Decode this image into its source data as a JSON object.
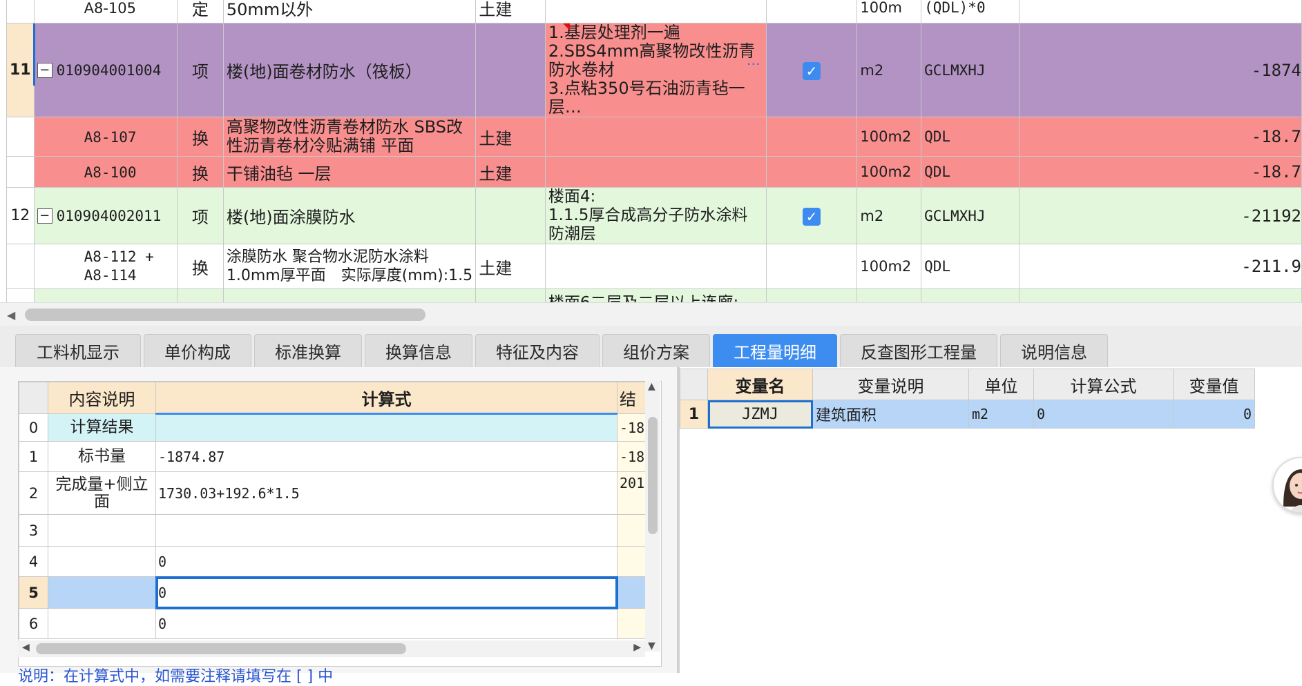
{
  "top_grid": {
    "prev_row": {
      "code": "A8-105",
      "type": "定",
      "name": "50mm以外",
      "major": "土建",
      "unit": "100m",
      "qty_expr": "(QDL)*0"
    },
    "rows": [
      {
        "num": "11",
        "code": "010904001004",
        "type": "项",
        "name": "楼(地)面卷材防水（筏板）",
        "major": "",
        "features": "1.基层处理剂一遍\n2.SBS4mm高聚物改性沥青防水卷材\n3.点粘350号石油沥青毡一层…",
        "unit": "m2",
        "qty_expr": "GCLMXHJ",
        "qty": "-1874"
      },
      {
        "num": "",
        "code": "A8-107",
        "type": "换",
        "name": "高聚物改性沥青卷材防水 SBS改性沥青卷材冷贴满铺 平面",
        "major": "土建",
        "features": "",
        "unit": "100m2",
        "qty_expr": "QDL",
        "qty": "-18.7"
      },
      {
        "num": "",
        "code": "A8-100",
        "type": "换",
        "name": "干铺油毡 一层",
        "major": "土建",
        "features": "",
        "unit": "100m2",
        "qty_expr": "QDL",
        "qty": "-18.7"
      },
      {
        "num": "12",
        "code": "010904002011",
        "type": "项",
        "name": "楼(地)面涂膜防水",
        "major": "",
        "features": "楼面4:\n1.1.5厚合成高分子防水涂料防潮层",
        "unit": "m2",
        "qty_expr": "GCLMXHJ",
        "qty": "-21192"
      },
      {
        "num": "",
        "code": "A8-112 +\nA8-114",
        "type": "换",
        "name": "涂膜防水 聚合物水泥防水涂料 1.0mm厚平面　实际厚度(mm):1.5",
        "major": "土建",
        "features": "",
        "unit": "100m2",
        "qty_expr": "QDL",
        "qty": "-211.9"
      },
      {
        "num": "",
        "code": "",
        "type": "",
        "name": "",
        "major": "",
        "features": "楼面6二层及二层以上连廊:",
        "unit": "",
        "qty_expr": "",
        "qty": ""
      }
    ],
    "more_icon": "ellipsis-icon",
    "check_icon": "checkmark-icon"
  },
  "tabs": [
    "工料机显示",
    "单价构成",
    "标准换算",
    "换算信息",
    "特征及内容",
    "组价方案",
    "工程量明细",
    "反查图形工程量",
    "说明信息"
  ],
  "active_tab": "工程量明细",
  "calc_grid": {
    "headers": {
      "desc": "内容说明",
      "formula": "计算式",
      "result": "结"
    },
    "rows": [
      {
        "rn": "0",
        "desc": "计算结果",
        "formula": "",
        "result": "-18"
      },
      {
        "rn": "1",
        "desc": "标书量",
        "formula": "-1874.87",
        "result": "-18"
      },
      {
        "rn": "2",
        "desc": "完成量+侧立面",
        "formula": "1730.03+192.6*1.5",
        "result": "201"
      },
      {
        "rn": "3",
        "desc": "",
        "formula": "",
        "result": ""
      },
      {
        "rn": "4",
        "desc": "",
        "formula": "0",
        "result": ""
      },
      {
        "rn": "5",
        "desc": "",
        "formula": "0",
        "result": ""
      },
      {
        "rn": "6",
        "desc": "",
        "formula": "0",
        "result": ""
      }
    ],
    "note": "说明：在计算式中，如需要注释请填写在 [ ] 中"
  },
  "var_grid": {
    "headers": [
      "变量名",
      "变量说明",
      "单位",
      "计算公式",
      "变量值"
    ],
    "rows": [
      {
        "rn": "1",
        "name": "JZMJ",
        "desc": "建筑面积",
        "unit": "m2",
        "formula": "0",
        "value": "0"
      }
    ]
  },
  "colors": {
    "accent": "#3d8cf0",
    "purple_row": "#b393c4",
    "red_row": "#f98e8e",
    "green_row": "#e2f7dc",
    "header_orange": "#fbe7c9",
    "selected_blue": "#b7d6f7"
  },
  "assistant_icon": "assistant-avatar-icon"
}
